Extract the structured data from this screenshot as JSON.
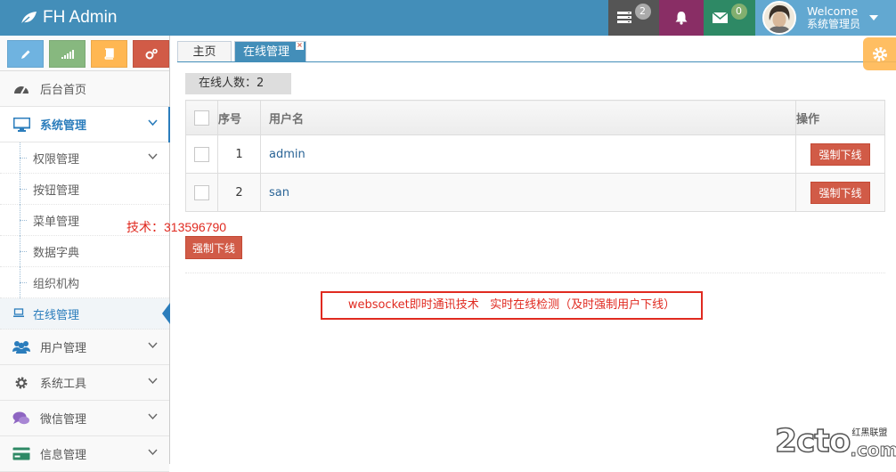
{
  "header": {
    "brand": "FH Admin",
    "tasks_count": "2",
    "messages_count": "0",
    "user_welcome": "Welcome",
    "user_role": "系统管理员"
  },
  "sidebar": {
    "home": "后台首页",
    "system_mgmt": "系统管理",
    "sub_items": [
      "权限管理",
      "按钮管理",
      "菜单管理",
      "数据字典",
      "组织机构",
      "在线管理"
    ],
    "user_mgmt": "用户管理",
    "system_tools": "系统工具",
    "wechat_mgmt": "微信管理",
    "info_mgmt": "信息管理"
  },
  "tabs": {
    "home": "主页",
    "active": "在线管理",
    "close_glyph": "×"
  },
  "main": {
    "online_count_label": "在线人数：2",
    "columns": [
      "序号",
      "用户名",
      "操作"
    ],
    "rows": [
      {
        "no": "1",
        "username": "admin",
        "action": "强制下线"
      },
      {
        "no": "2",
        "username": "san",
        "action": "强制下线"
      }
    ],
    "bulk_action": "强制下线",
    "tech_note": "技术：313596790",
    "annotation": "websocket即时通讯技术   实时在线检测（及时强制用户下线）"
  },
  "watermark": {
    "big": "2cto",
    "small": "红黑联盟",
    "domain": ".com"
  },
  "colors": {
    "navbar": "#438eb9",
    "danger": "#d15b47",
    "accent": "#2b7dbc"
  }
}
